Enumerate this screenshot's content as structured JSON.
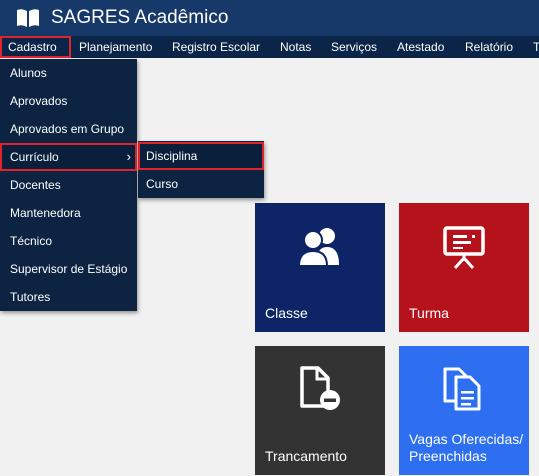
{
  "header": {
    "title": "SAGRES Acadêmico",
    "logo_icon": "book-icon"
  },
  "menubar": {
    "items": [
      {
        "label": "Cadastro",
        "active": true
      },
      {
        "label": "Planejamento"
      },
      {
        "label": "Registro Escolar"
      },
      {
        "label": "Notas"
      },
      {
        "label": "Serviços"
      },
      {
        "label": "Atestado"
      },
      {
        "label": "Relatório"
      },
      {
        "label": "T"
      }
    ]
  },
  "cadastro_menu": {
    "items": [
      {
        "label": "Alunos"
      },
      {
        "label": "Aprovados"
      },
      {
        "label": "Aprovados em Grupo"
      },
      {
        "label": "Currículo",
        "active": true,
        "has_submenu": true,
        "chevron": "›"
      },
      {
        "label": "Docentes"
      },
      {
        "label": "Mantenedora"
      },
      {
        "label": "Técnico"
      },
      {
        "label": "Supervisor de Estágio"
      },
      {
        "label": "Tutores"
      }
    ]
  },
  "curriculo_submenu": {
    "items": [
      {
        "label": "Disciplina",
        "active": true
      },
      {
        "label": "Curso"
      }
    ]
  },
  "tiles": [
    {
      "label": "Classe",
      "icon": "users-icon",
      "color": "#0d2466"
    },
    {
      "label": "Turma",
      "icon": "presentation-board-icon",
      "color": "#b5121b"
    },
    {
      "label": "Trancamento",
      "icon": "document-remove-icon",
      "color": "#333333"
    },
    {
      "label": "Vagas Oferecidas/ Preenchidas",
      "icon": "documents-copy-icon",
      "color": "#2d6ff0"
    }
  ],
  "colors": {
    "header_bg": "#17396a",
    "menubar_bg": "#0b2549",
    "dropdown_bg": "#0c2342",
    "highlight_border": "#e0242b",
    "page_bg": "#f1f1f1"
  }
}
